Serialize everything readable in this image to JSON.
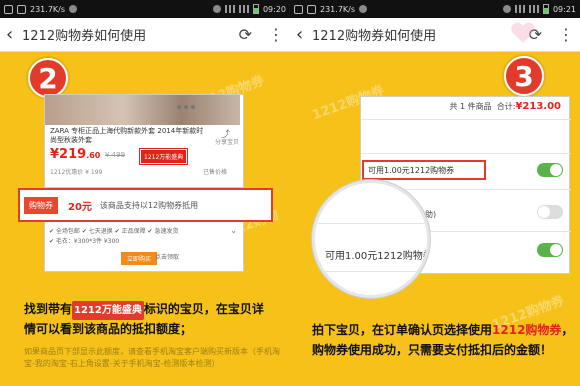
{
  "status": {
    "network_speed_left": "231.7K/s",
    "time_left": "09:20",
    "network_speed_right": "231.7K/s",
    "time_right": "09:21"
  },
  "nav": {
    "title": "1212购物券如何使用",
    "back_icon": "back-arrow-icon",
    "refresh_icon": "refresh-icon",
    "more_icon": "more-vertical-icon"
  },
  "watermark": "1212购物券",
  "step1": {
    "number": "2",
    "product_title": "ZARA 专柜正品上海代购新款外套 2014年新款时尚型秋装外套",
    "share_label": "分享宝贝",
    "price_main": "¥219",
    "price_decimal": ".60",
    "orig_price": "¥ 499",
    "tag_1212": "1212万能盛典",
    "left_line": "1212优惠价 ¥ 199",
    "right_line": "已售价格",
    "coupon_tag": "购物券",
    "coupon_amount": "20元",
    "coupon_desc": "该商品支持以12购物券抵用",
    "check1": "✔ 全场包邮 ✔ 七天退换 ✔ 正品保障 ✔ 急速发货",
    "check2": "✔ 毛衣：¥300*3件 ¥300",
    "btn_orange": "立即购买",
    "btn_link": "点击领取",
    "caption_a": "找到带有",
    "caption_badge": "1212万能盛典",
    "caption_b": "标识的宝贝，在宝贝详情可以看到该商品的抵扣额度；",
    "faint_text": "如果商品页下部显示此额度，请查看手机淘宝客户端购买新版本（手机淘宝-我的淘宝-右上角设置-关于手机淘宝-检测版本检测）"
  },
  "step2": {
    "number": "3",
    "items_count": "共 1 件商品",
    "total_label": "合计:",
    "total_value": "¥213.00",
    "coupon_line": "可用1.00元1212购物券",
    "fragment_right": "普助)",
    "magnify_text": "可用1.00元1212购物券",
    "caption_a": "拍下宝贝，在订单确认页选择使用",
    "caption_red": "1212购物券",
    "caption_b": "，购物券使用成功，只需要支付抵扣后的金额！"
  }
}
